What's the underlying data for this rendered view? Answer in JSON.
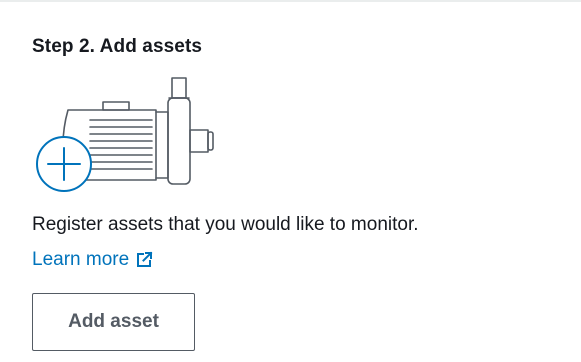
{
  "card": {
    "title": "Step 2. Add assets",
    "description": "Register assets that you would like to monitor.",
    "learn_more": "Learn more",
    "add_button": "Add asset"
  },
  "icons": {
    "illustration": "motor-pump-icon",
    "add_badge": "plus-circle-icon",
    "learn_more": "external-link-icon"
  },
  "colors": {
    "link": "#0073bb",
    "text": "#16191f",
    "button_border": "#545b64",
    "accent": "#0073bb"
  }
}
